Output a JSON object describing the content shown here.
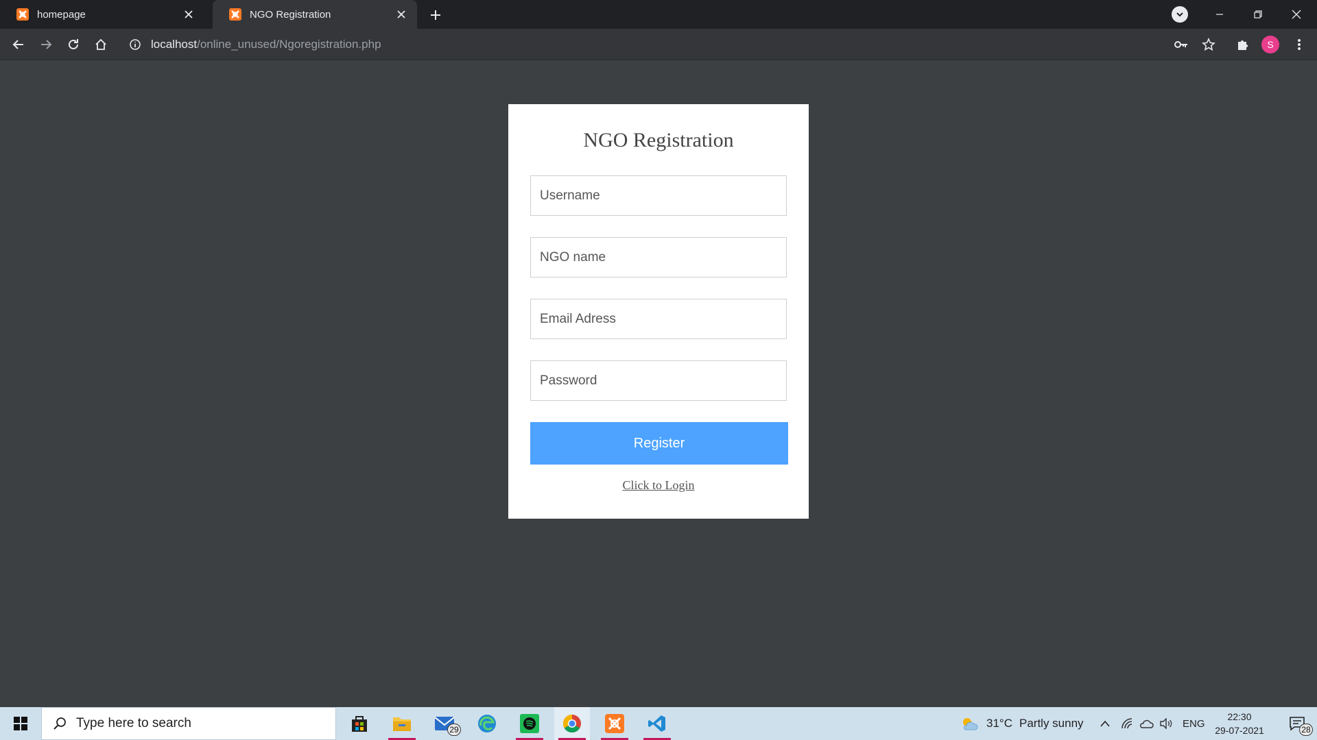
{
  "browser": {
    "tabs": [
      {
        "title": "homepage",
        "active": false
      },
      {
        "title": "NGO Registration",
        "active": true
      }
    ],
    "url_host": "localhost",
    "url_path": "/online_unused/Ngoregistration.php",
    "profile_initial": "S",
    "accent_colors": {
      "tabstrip": "#202124",
      "toolbar": "#35363a",
      "profile": "#e83e8c"
    }
  },
  "page": {
    "title": "NGO Registration",
    "fields": {
      "username": {
        "placeholder": "Username",
        "value": ""
      },
      "ngo_name": {
        "placeholder": "NGO name",
        "value": ""
      },
      "email": {
        "placeholder": "Email Adress",
        "value": ""
      },
      "password": {
        "placeholder": "Password",
        "value": ""
      }
    },
    "register_label": "Register",
    "login_link": "Click to Login",
    "colors": {
      "background": "#3c4043",
      "button": "#4da3ff"
    }
  },
  "taskbar": {
    "search_placeholder": "Type here to search",
    "mail_badge": "29",
    "weather": {
      "temp": "31°C",
      "desc": "Partly sunny"
    },
    "language": "ENG",
    "time": "22:30",
    "date": "29-07-2021",
    "notifications": "28"
  }
}
